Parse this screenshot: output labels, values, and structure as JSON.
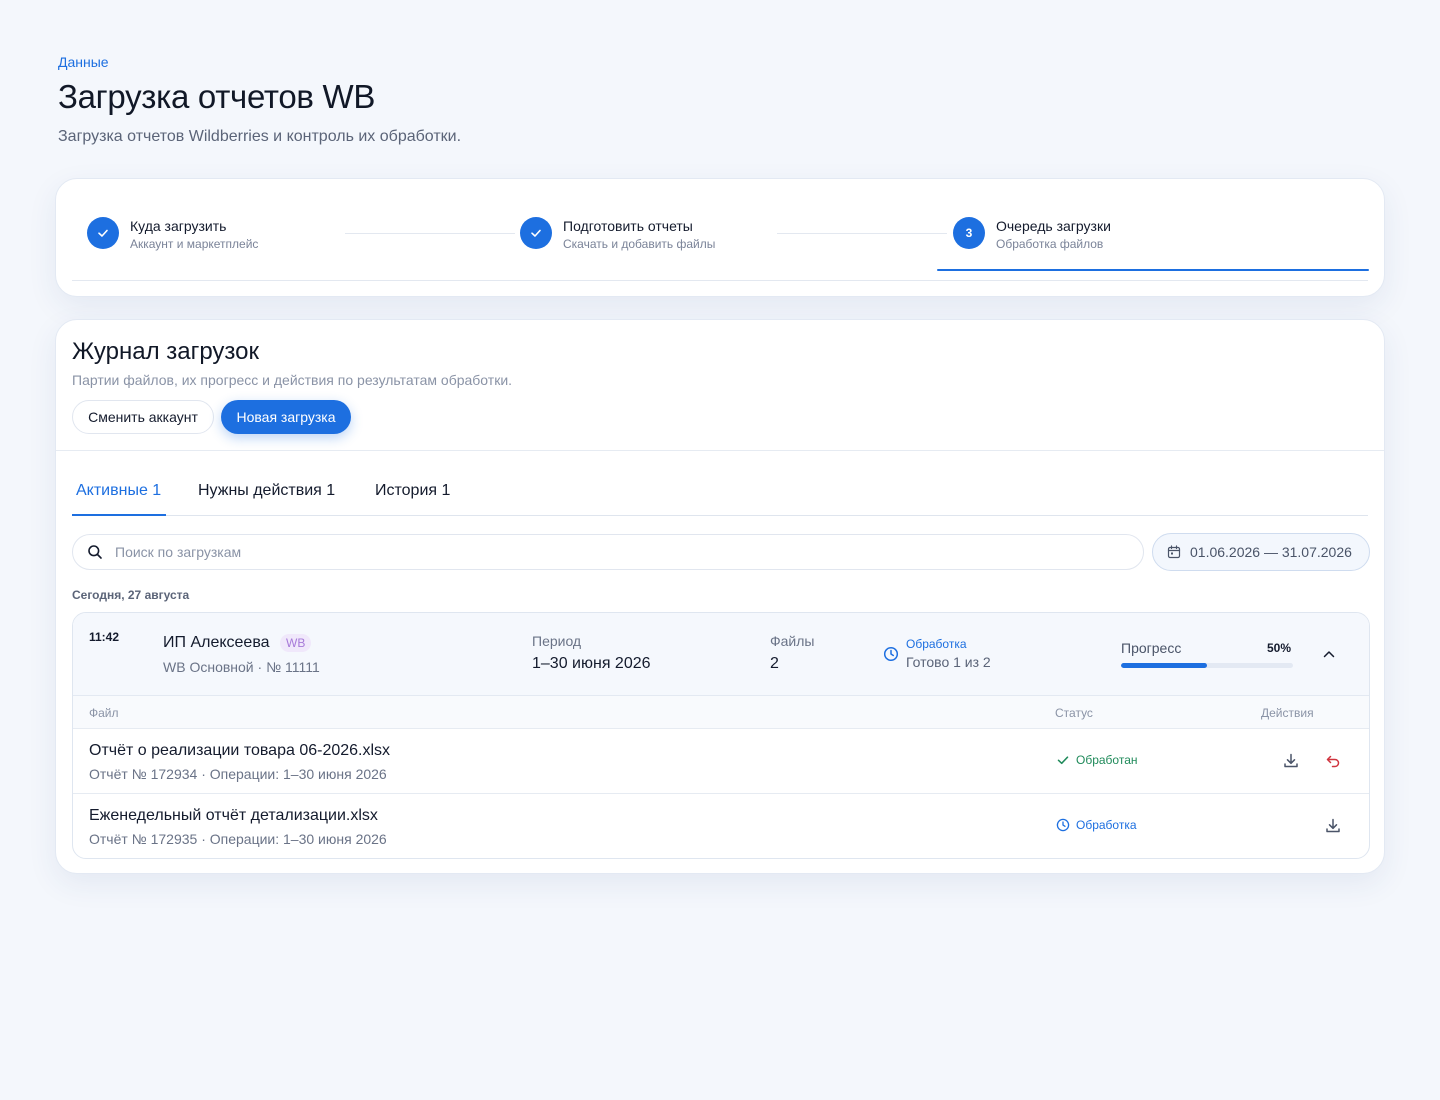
{
  "header": {
    "breadcrumb": "Данные",
    "title": "Загрузка отчетов WB",
    "subtitle": "Загрузка отчетов Wildberries и контроль их обработки."
  },
  "stepper": {
    "steps": [
      {
        "title": "Куда загрузить",
        "subtitle": "Аккаунт и маркетплейс",
        "state": "done"
      },
      {
        "title": "Подготовить отчеты",
        "subtitle": "Скачать и добавить файлы",
        "state": "done"
      },
      {
        "number": "3",
        "title": "Очередь загрузки",
        "subtitle": "Обработка файлов",
        "state": "active"
      }
    ]
  },
  "journal": {
    "title": "Журнал загрузок",
    "subtitle": "Партии файлов, их прогресс и действия по результатам обработки.",
    "change_account_label": "Сменить аккаунт",
    "new_upload_label": "Новая загрузка",
    "tabs": [
      {
        "label": "Активные 1",
        "active": true
      },
      {
        "label": "Нужны действия 1",
        "active": false
      },
      {
        "label": "История 1",
        "active": false
      }
    ],
    "search": {
      "placeholder": "Поиск по загрузкам",
      "value": ""
    },
    "date_range": "01.06.2026 — 31.07.2026",
    "day_label": "Сегодня, 27 августа",
    "batch": {
      "time": "11:42",
      "account_name": "ИП Алексеева",
      "marketplace_badge": "WB",
      "account_meta": "WB Основной · № 11111",
      "period_label": "Период",
      "period_value": "1–30 июня 2026",
      "files_label": "Файлы",
      "files_value": "2",
      "status_label": "Обработка",
      "status_value": "Готово 1 из 2",
      "progress_label": "Прогресс",
      "progress_percent": "50%",
      "progress_fraction": 0.5,
      "table": {
        "col_file": "Файл",
        "col_status": "Статус",
        "col_actions": "Действия"
      },
      "files": [
        {
          "name": "Отчёт о реализации товара 06-2026.xlsx",
          "meta": "Отчёт № 172934 · Операции: 1–30 июня 2026",
          "status": "Обработан",
          "status_icon": "check-icon",
          "actions": [
            "download-icon",
            "undo-icon"
          ]
        },
        {
          "name": "Еженедельный отчёт детализации.xlsx",
          "meta": "Отчёт № 172935 · Операции: 1–30 июня 2026",
          "status": "Обработка",
          "status_icon": "clock-icon",
          "actions": [
            "download-icon"
          ]
        }
      ]
    }
  },
  "colors": {
    "accent": "#1d6fe0",
    "success": "#1f8a5a",
    "danger": "#d0343f",
    "badge_bg": "#f0e8fb",
    "badge_text": "#a77ad9",
    "page_bg": "#f4f7fc"
  }
}
